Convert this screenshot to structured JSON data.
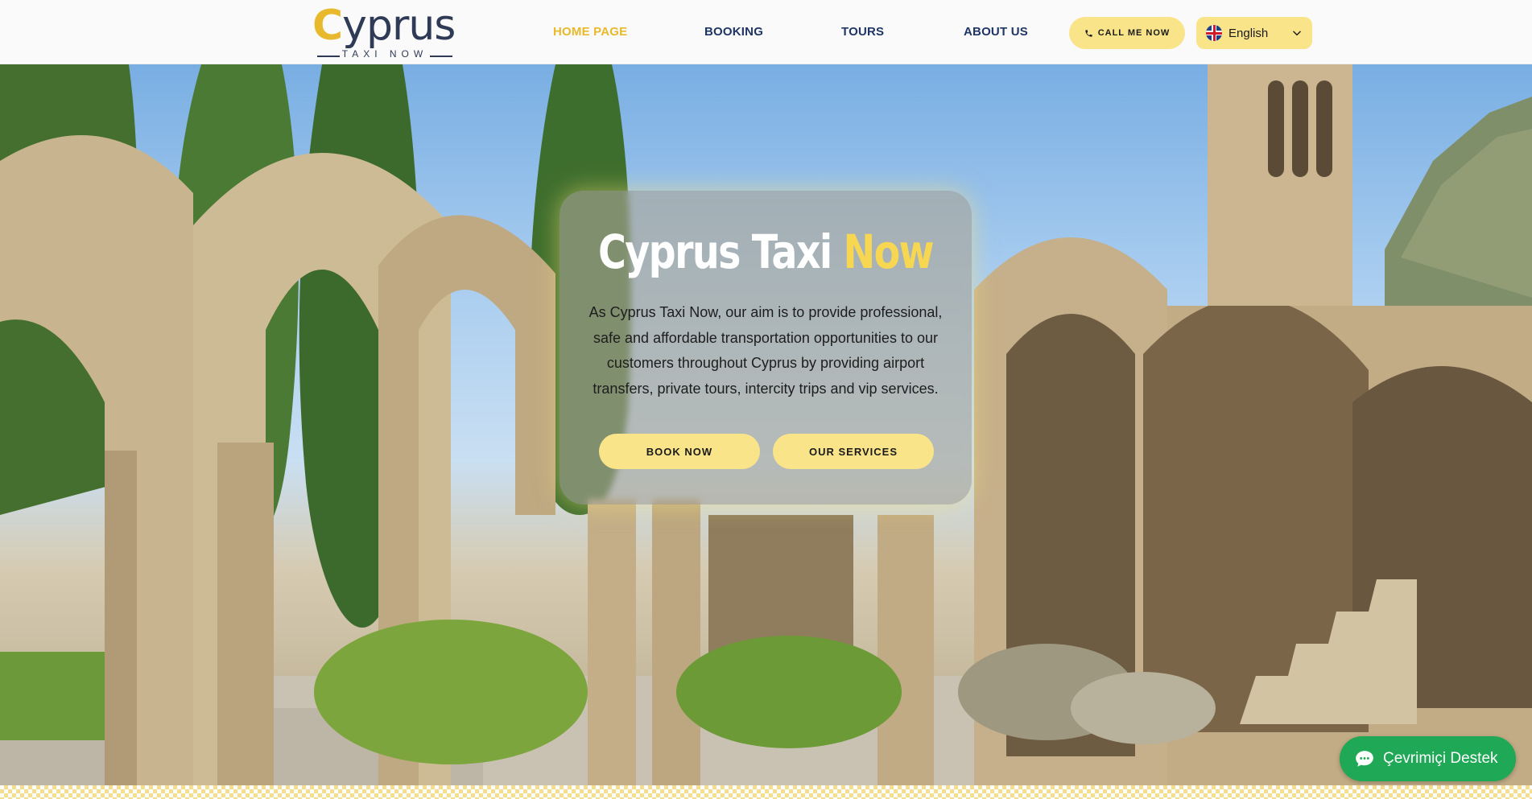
{
  "header": {
    "logo": {
      "word": "yprus",
      "letter": "C",
      "subtitle": "TAXI NOW"
    },
    "nav": [
      {
        "label": "HOME PAGE",
        "active": true
      },
      {
        "label": "BOOKING",
        "active": false
      },
      {
        "label": "TOURS",
        "active": false
      },
      {
        "label": "ABOUT US",
        "active": false
      }
    ],
    "call_label": "CALL ME NOW",
    "language": {
      "selected": "English",
      "flag_icon": "uk-flag-icon"
    }
  },
  "hero": {
    "title_main": "Cyprus Taxi ",
    "title_accent": "Now",
    "description": "As Cyprus Taxi Now, our aim is to provide professional, safe and affordable transportation opportunities to our customers throughout Cyprus by providing airport transfers, private tours, intercity trips and vip services.",
    "book_label": "BOOK NOW",
    "services_label": "OUR SERVICES",
    "background": "gothic abbey ruins with cypress trees"
  },
  "chat": {
    "label": "Çevrimiçi Destek",
    "icon": "chat-bubble-icon"
  },
  "colors": {
    "accent": "#e8b92c",
    "button": "#f9e48a",
    "nav_text": "#1f3566",
    "chat_green": "#1fa855"
  }
}
